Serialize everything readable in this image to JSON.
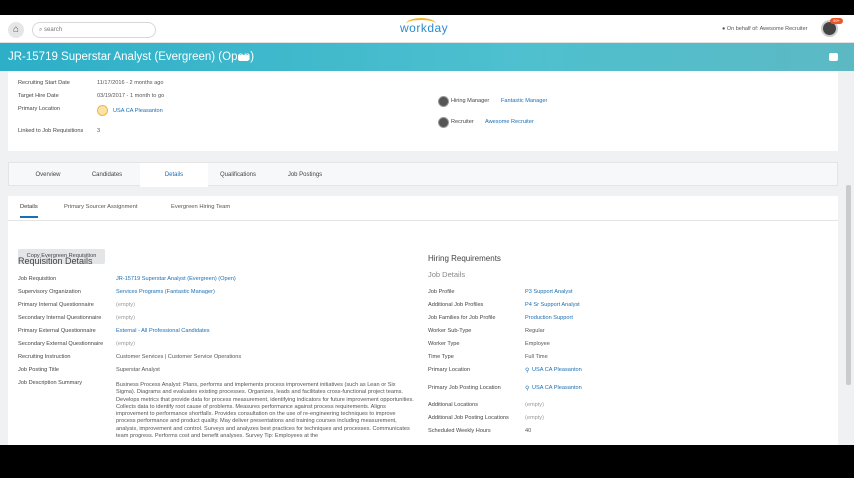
{
  "header": {
    "search_placeholder": "search",
    "logo": "workday",
    "on_behalf": "On behalf of: Awesome Recruiter",
    "notification_count": "99+"
  },
  "title": "JR-15719 Superstar Analyst (Evergreen) (Open)",
  "summary": {
    "fields": [
      {
        "label": "Recruiting Start Date",
        "value": "11/17/2016 - 2 months ago"
      },
      {
        "label": "Target Hire Date",
        "value": "03/19/2017 - 1 month to go"
      },
      {
        "label": "Primary Location",
        "value": "USA CA Pleasanton"
      },
      {
        "label": "Linked to Job Requisitions",
        "value": "3"
      }
    ],
    "people": [
      {
        "label": "Hiring Manager",
        "value": "Fantastic Manager"
      },
      {
        "label": "Recruiter",
        "value": "Awesome Recruiter"
      }
    ]
  },
  "tabs": [
    "Overview",
    "Candidates",
    "Details",
    "Qualifications",
    "Job Postings"
  ],
  "subtabs": [
    "Details",
    "Primary Sourcer Assignment",
    "Evergreen Hiring Team"
  ],
  "copy_button": "Copy Evergreen Requisition",
  "requisition": {
    "heading": "Requisition Details",
    "rows": [
      {
        "label": "Job Requisition",
        "value": "JR-15719 Superstar Analyst (Evergreen) (Open)",
        "type": "link"
      },
      {
        "label": "Supervisory Organization",
        "value": "Services Programs (Fantastic Manager)",
        "type": "link"
      },
      {
        "label": "Primary Internal Questionnaire",
        "value": "(empty)",
        "type": "empty"
      },
      {
        "label": "Secondary Internal Questionnaire",
        "value": "(empty)",
        "type": "empty"
      },
      {
        "label": "Primary External Questionnaire",
        "value": "External - All Professional Candidates",
        "type": "link"
      },
      {
        "label": "Secondary External Questionnaire",
        "value": "(empty)",
        "type": "empty"
      },
      {
        "label": "Recruiting Instruction",
        "value": "Customer Services | Customer Service Operations",
        "type": "text"
      },
      {
        "label": "Job Posting Title",
        "value": "Superstar Analyst",
        "type": "text"
      },
      {
        "label": "Job Description Summary",
        "value": "",
        "type": "text"
      }
    ],
    "description": "Business Process Analyst: Plans, performs and implements process improvement initiatives (such as Lean or Six Sigma). Diagrams and evaluates existing processes. Organizes, leads and facilitates cross-functional project teams. Develops metrics that provide data for process measurement, identifying indicators for future improvement opportunities. Collects data to identify root cause of problems. Measures performance against process requirements. Aligns improvement to performance shortfalls. Provides consultation on the use of re-engineering techniques to improve process performance and product quality. May deliver presentations and training courses including measurement, analysis, improvement and control. Surveys and analyzes best practices for techniques and processes. Communicates team progress. Performs cost and benefit analyses. Survey Tip: Employees at the"
  },
  "hiring": {
    "heading": "Hiring Requirements",
    "subheading": "Job Details",
    "rows": [
      {
        "label": "Job Profile",
        "value": "P3 Support Analyst",
        "type": "link"
      },
      {
        "label": "Additional Job Profiles",
        "value": "P4 Sr Support Analyst",
        "type": "link"
      },
      {
        "label": "Job Families for Job Profile",
        "value": "Production Support",
        "type": "link"
      },
      {
        "label": "Worker Sub-Type",
        "value": "Regular",
        "type": "text"
      },
      {
        "label": "Worker Type",
        "value": "Employee",
        "type": "text"
      },
      {
        "label": "Time Type",
        "value": "Full Time",
        "type": "text"
      },
      {
        "label": "Primary Location",
        "value": "USA CA Pleasanton",
        "type": "loc"
      },
      {
        "label": "Primary Job Posting Location",
        "value": "USA CA Pleasanton",
        "type": "loc"
      },
      {
        "label": "Additional Locations",
        "value": "(empty)",
        "type": "empty"
      },
      {
        "label": "Additional Job Posting Locations",
        "value": "(empty)",
        "type": "empty"
      },
      {
        "label": "Scheduled Weekly Hours",
        "value": "40",
        "type": "text"
      }
    ]
  }
}
